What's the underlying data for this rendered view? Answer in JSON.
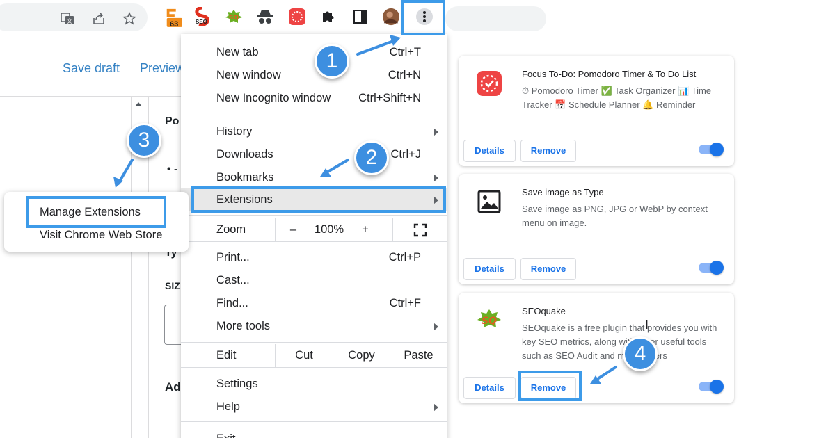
{
  "toolbar": {
    "icons": [
      "translate-icon",
      "share-icon",
      "star-icon",
      "amazon-extension-icon",
      "seo-extension-icon",
      "seoquake-extension-icon",
      "incognito-extension-icon",
      "focus-todo-extension-icon",
      "puzzle-icon",
      "side-panel-icon",
      "profile-avatar",
      "kebab-menu-icon"
    ],
    "amazon_badge": "63",
    "seo_ext_label": "SEO"
  },
  "background": {
    "save_draft": "Save draft",
    "preview": "Preview",
    "fragments": [
      "Po",
      "• -",
      "Ty",
      "SIZ",
      "Ad"
    ]
  },
  "menu": {
    "items": [
      {
        "label": "New tab",
        "shortcut": "Ctrl+T"
      },
      {
        "label": "New window",
        "shortcut": "Ctrl+N"
      },
      {
        "label": "New Incognito window",
        "shortcut": "Ctrl+Shift+N"
      },
      {
        "label": "History",
        "shortcut": ""
      },
      {
        "label": "Downloads",
        "shortcut": "Ctrl+J"
      },
      {
        "label": "Bookmarks",
        "shortcut": ""
      },
      {
        "label": "Extensions",
        "shortcut": ""
      },
      {
        "label": "Print...",
        "shortcut": "Ctrl+P"
      },
      {
        "label": "Cast...",
        "shortcut": ""
      },
      {
        "label": "Find...",
        "shortcut": "Ctrl+F"
      },
      {
        "label": "More tools",
        "shortcut": ""
      },
      {
        "label": "Settings",
        "shortcut": ""
      },
      {
        "label": "Help",
        "shortcut": ""
      },
      {
        "label": "Exit",
        "shortcut": ""
      }
    ],
    "zoom": {
      "label": "Zoom",
      "minus": "–",
      "value": "100%",
      "plus": "+"
    },
    "edit": {
      "label": "Edit",
      "cut": "Cut",
      "copy": "Copy",
      "paste": "Paste"
    }
  },
  "submenu": {
    "manage": "Manage Extensions",
    "store": "Visit Chrome Web Store"
  },
  "extensions": [
    {
      "name": "Focus To-Do: Pomodoro Timer & To Do List",
      "description": "⏱ Pomodoro Timer ✅ Task Organizer 📊 Time Tracker 📅 Schedule Planner 🔔 Reminder",
      "details": "Details",
      "remove": "Remove",
      "enabled": true
    },
    {
      "name": "Save image as Type",
      "description": "Save image as PNG, JPG or WebP by context menu on image.",
      "details": "Details",
      "remove": "Remove",
      "enabled": true
    },
    {
      "name": "SEOquake",
      "description": "SEOquake is a free plugin that provides you with key SEO metrics, along with other useful tools such as SEO Audit and many others",
      "details": "Details",
      "remove": "Remove",
      "enabled": true
    }
  ],
  "annotations": {
    "step1": "1",
    "step2": "2",
    "step3": "3",
    "step4": "4",
    "color": "#3d9be9"
  }
}
